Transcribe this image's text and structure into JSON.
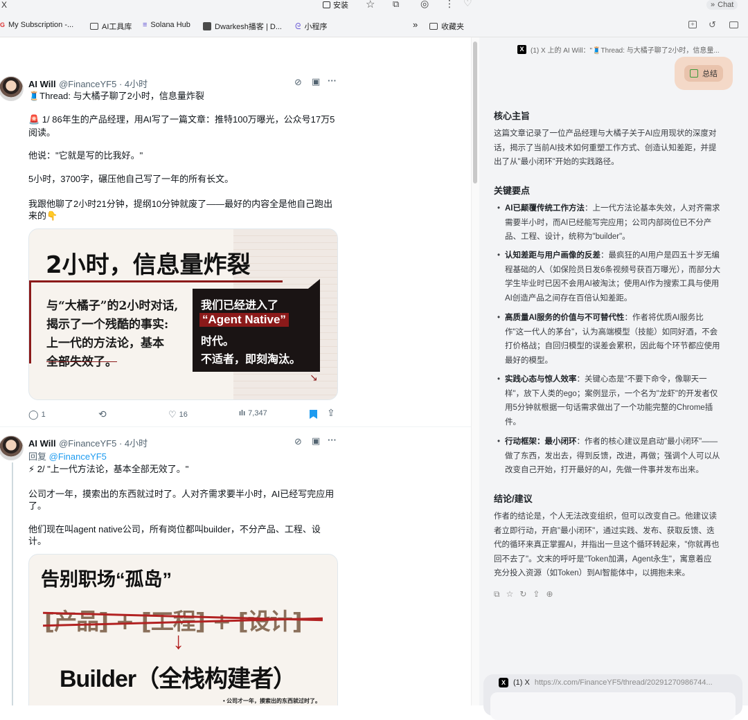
{
  "browser": {
    "tab_close": "X",
    "install_label": "安装",
    "chat_label": "Chat",
    "bookmarks": [
      {
        "label": "My Subscription -..."
      },
      {
        "label": "AI工具库"
      },
      {
        "label": "Solana Hub"
      },
      {
        "label": "Dwarkesh播客 | D..."
      },
      {
        "label": "小程序"
      },
      {
        "label": "收藏夹"
      }
    ],
    "bookmarks_more": "»"
  },
  "tweets": [
    {
      "name": "AI Will",
      "handle": "@FinanceYF5 · 4小时",
      "lines": [
        "🧵Thread: 与大橘子聊了2小时，信息量炸裂",
        "🚨 1/ 86年生的产品经理，用AI写了一篇文章：推特100万曝光，公众号17万5",
        "阅读。",
        "他说：\"它就是写的比我好。\"",
        "5小时，3700字，碾压他自己写了一年的所有长文。",
        "我跟他聊了2小时21分钟，提纲10分钟就废了——最好的内容全是他自己跑出",
        "来的👇"
      ],
      "card": {
        "title": "2小时，信息量炸裂",
        "left_lines": [
          "与“大橘子”的2小时对话,",
          "揭示了一个残酷的事实:",
          "上一代的方法论，基本",
          "全部失效了。"
        ],
        "box_line1": "我们已经进入了",
        "box_highlight": "“Agent Native”",
        "box_line3": "时代。",
        "box_line4": "不适者，即刻淘汰。"
      },
      "stats": {
        "replies": "1",
        "likes": "16",
        "views": "7,347"
      }
    },
    {
      "name": "AI Will",
      "handle": "@FinanceYF5 · 4小时",
      "reply_prefix": "回复 ",
      "reply_to": "@FinanceYF5",
      "lines": [
        "⚡ 2/ \"上一代方法论，基本全部无效了。\"",
        "公司才一年，摸索出的东西就过时了。人对齐需求要半小时，AI已经写完应用",
        "了。",
        "他们现在叫agent native公司，所有岗位都叫builder，不分产品、工程、设",
        "计。"
      ],
      "card": {
        "title": "告别职场“孤岛”",
        "crossed": "[产品] + [工程] + [设计]",
        "arrow": "↓",
        "result": "Builder（全栈构建者）",
        "footnote": "• 公司才一年，摸索出的东西就过时了。"
      }
    }
  ],
  "panel": {
    "source_title": "(1) X 上的 AI Will：\"🧵Thread: 与大橘子聊了2小时，信息量...",
    "summarize_label": "总结",
    "section1_title": "核心主旨",
    "section1_lines": [
      "这篇文章记录了一位产品经理与大橘子关于AI应用现状的深度对",
      "话，揭示了当前AI技术如何重塑工作方式、创造认知差距，并提",
      "出了从\"最小闭环\"开始的实践路径。"
    ],
    "section2_title": "关键要点",
    "points": [
      {
        "head": "AI已颠覆传统工作方法",
        "lines": [
          "：上一代方法论基本失效，人对齐需求",
          "需要半小时，而AI已经能写完应用；公司内部岗位已不分产",
          "品、工程、设计，统称为\"builder\"。"
        ]
      },
      {
        "head": "认知差距与用户画像的反差",
        "lines": [
          "：最疯狂的AI用户是四五十岁无编",
          "程基础的人（如保险员日发6条视频号获百万曝光），而部分大",
          "学生毕业时已因不会用AI被淘汰；使用AI作为搜索工具与使用",
          "AI创造产品之间存在百倍认知差距。"
        ]
      },
      {
        "head": "高质量AI服务的价值与不可替代性",
        "lines": [
          "：作者将优质AI服务比",
          "作\"这一代人的茅台\"，认为高端模型（技能）如同好酒，不会",
          "打价格战；自回归模型的误差会累积，因此每个环节都应使用",
          "最好的模型。"
        ]
      },
      {
        "head": "实践心态与惊人效率",
        "lines": [
          "：关键心态是\"不要下命令，像聊天一",
          "样\"，放下人类的ego；案例显示，一个名为\"龙虾\"的开发者仅",
          "用5分钟就根据一句话需求做出了一个功能完整的Chrome插",
          "件。"
        ]
      },
      {
        "head": "行动框架：最小闭环",
        "lines": [
          "：作者的核心建议是启动\"最小闭环\"——",
          "做了东西，发出去，得到反馈，改进，再做；强调个人可以从",
          "改变自己开始，打开最好的AI，先做一件事并发布出来。"
        ]
      }
    ],
    "section3_title": "结论/建议",
    "section3_lines": [
      "作者的结论是，个人无法改变组织，但可以改变自己。他建议读",
      "者立即行动，开启\"最小闭环\"，通过实践、发布、获取反馈、迭",
      "代的循环来真正掌握AI，并指出一旦这个循环转起来，\"你就再也",
      "回不去了\"。文末的呼吁是\"Token加满，Agent永生\"，寓意着应",
      "充分投入资源（如Token）到AI智能体中，以拥抱未来。"
    ],
    "bottom_title": "(1) X",
    "bottom_url": "https://x.com/FinanceYF5/thread/20291270986744..."
  }
}
